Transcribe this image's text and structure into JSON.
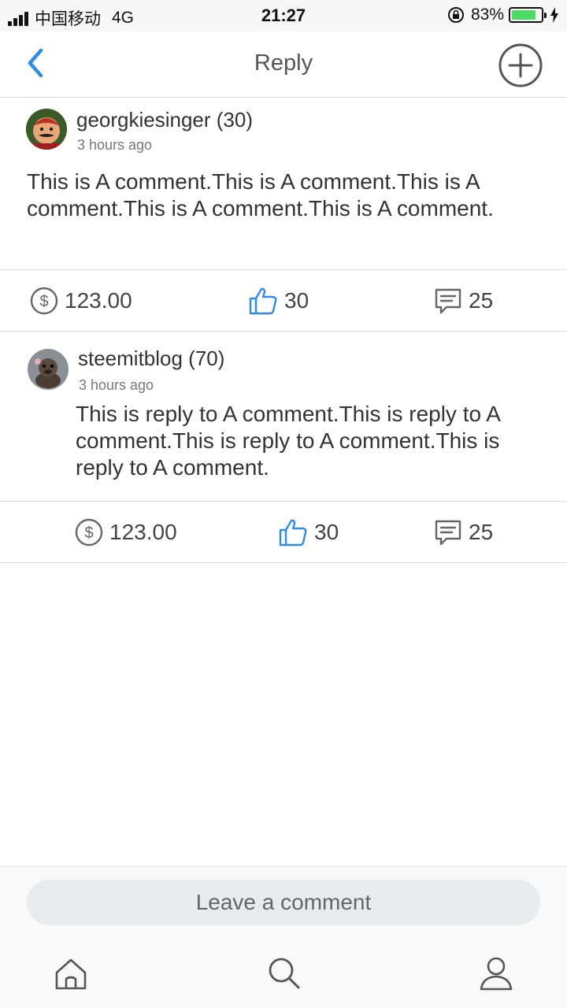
{
  "status_bar": {
    "carrier": "中国移动",
    "network": "4G",
    "time": "21:27",
    "battery": "83%",
    "battery_level": 0.83
  },
  "nav": {
    "title": "Reply",
    "back_icon": "chevron-left-icon",
    "add_icon": "plus-circle-icon"
  },
  "colors": {
    "accent": "#2f8ae8",
    "battery_green": "#4cd964",
    "divider": "#dcdcdc"
  },
  "comments": [
    {
      "username": "georgkiesinger (30)",
      "time": "3 hours ago",
      "body": "This is A comment.This is A comment.This is A comment.This is A comment.This is A comment.",
      "payout": "123.00",
      "likes": "30",
      "replies": "25"
    },
    {
      "username": "steemitblog (70)",
      "time": "3 hours ago",
      "body": "This is reply to A comment.This is reply to A comment.This is reply to A comment.This is reply to A comment.",
      "payout": "123.00",
      "likes": "30",
      "replies": "25"
    }
  ],
  "footer": {
    "comment_placeholder": "Leave a comment",
    "tabs": [
      "home-icon",
      "search-icon",
      "profile-icon"
    ]
  }
}
